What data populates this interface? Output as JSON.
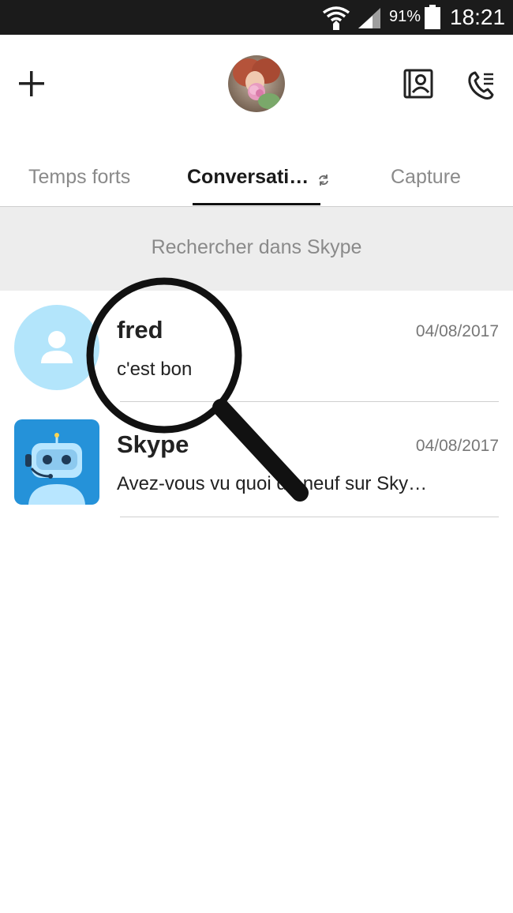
{
  "status_bar": {
    "battery_percent": "91%",
    "time": "18:21",
    "icons": [
      "wifi-icon",
      "signal-icon",
      "battery-icon"
    ]
  },
  "header": {
    "icons": [
      "plus-icon",
      "profile-avatar",
      "contacts-icon",
      "call-log-icon"
    ]
  },
  "tabs": [
    {
      "label": "Temps forts",
      "active": false
    },
    {
      "label": "Conversati…",
      "active": true
    },
    {
      "label": "Capture",
      "active": false
    }
  ],
  "search": {
    "placeholder": "Rechercher dans Skype"
  },
  "conversations": [
    {
      "name": "fred",
      "date": "04/08/2017",
      "preview": "c'est bon",
      "avatar": "default-user-avatar"
    },
    {
      "name": "Skype",
      "date": "04/08/2017",
      "preview": "Avez-vous vu quoi de neuf sur Sky…",
      "avatar": "skype-bot-avatar"
    }
  ],
  "colors": {
    "status_bar_bg": "#1b1b1b",
    "search_bg": "#ededed",
    "avatar_default_bg": "#b3e5fb",
    "bot_avatar_bg": "#2592d9",
    "active_tab_underline": "#111111"
  }
}
